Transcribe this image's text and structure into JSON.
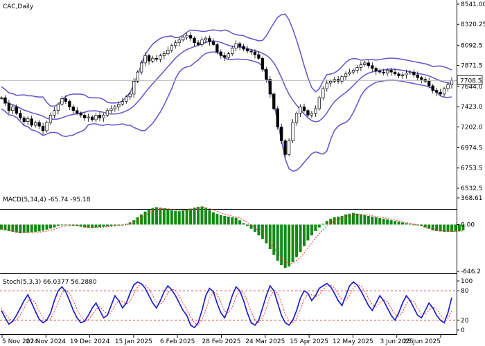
{
  "chart_data": {
    "type": "candlestick",
    "colors": {
      "bull": "#000000",
      "bear": "#000000",
      "bollinger": "#6a5acd",
      "macd_hist": "#138a13",
      "macd_signal": "#ff2a2a",
      "stoch_k": "#1c1cd6",
      "stoch_d": "#ff2a2a",
      "grid": "#c8c8c8"
    },
    "main": {
      "title": "CAC,Daily",
      "current_price": "7708.5",
      "y_ticks": [
        "8541.00",
        "8320.25",
        "8092.5",
        "7871.5",
        "7644.0",
        "7423.0",
        "7202.0",
        "6974.5",
        "6753.5",
        "6532.5"
      ],
      "ylim": [
        6532.5,
        8541.0
      ],
      "indicator": "Bollinger Bands",
      "closes": [
        7520,
        7460,
        7380,
        7420,
        7350,
        7300,
        7260,
        7290,
        7220,
        7250,
        7210,
        7160,
        7250,
        7330,
        7380,
        7450,
        7510,
        7480,
        7420,
        7380,
        7350,
        7330,
        7300,
        7310,
        7280,
        7330,
        7300,
        7330,
        7380,
        7400,
        7420,
        7450,
        7480,
        7530,
        7560,
        7700,
        7800,
        7900,
        7980,
        7920,
        7950,
        7940,
        7980,
        8000,
        8040,
        8090,
        8120,
        8150,
        8180,
        8200,
        8170,
        8120,
        8100,
        8150,
        8170,
        8130,
        8100,
        8020,
        7980,
        7960,
        8000,
        8060,
        8110,
        8080,
        8050,
        8030,
        8020,
        7990,
        7950,
        7830,
        7720,
        7560,
        7400,
        7200,
        7050,
        6900,
        7050,
        7250,
        7350,
        7420,
        7380,
        7330,
        7350,
        7400,
        7520,
        7620,
        7680,
        7700,
        7720,
        7700,
        7750,
        7780,
        7800,
        7820,
        7850,
        7880,
        7900,
        7870,
        7840,
        7810,
        7800,
        7790,
        7820,
        7800,
        7780,
        7760,
        7770,
        7790,
        7800,
        7770,
        7740,
        7720,
        7700,
        7650,
        7600,
        7580,
        7560,
        7620,
        7660,
        7708
      ]
    },
    "macd": {
      "label": "MACD(5,34,4)",
      "value1": "-65.74",
      "value2": "-95.18",
      "y_ticks": [
        "368.61",
        "0.00",
        "-646.2"
      ],
      "ylim": [
        -646.2,
        368.61
      ],
      "histogram": [
        -70,
        -80,
        -90,
        -100,
        -110,
        -120,
        -115,
        -110,
        -105,
        -100,
        -95,
        -85,
        -70,
        -55,
        -40,
        -20,
        -10,
        -5,
        -8,
        -15,
        -20,
        -30,
        -40,
        -45,
        -50,
        -40,
        -35,
        -30,
        -25,
        -20,
        -15,
        -10,
        -5,
        10,
        30,
        60,
        100,
        140,
        180,
        210,
        230,
        240,
        235,
        225,
        210,
        200,
        190,
        185,
        195,
        210,
        220,
        235,
        245,
        250,
        230,
        200,
        170,
        150,
        130,
        120,
        110,
        100,
        95,
        60,
        20,
        -20,
        -60,
        -100,
        -150,
        -200,
        -260,
        -340,
        -420,
        -500,
        -560,
        -600,
        -580,
        -520,
        -450,
        -380,
        -300,
        -220,
        -150,
        -90,
        -40,
        10,
        50,
        80,
        100,
        110,
        120,
        140,
        150,
        160,
        150,
        140,
        130,
        120,
        110,
        100,
        90,
        80,
        70,
        60,
        50,
        40,
        30,
        20,
        10,
        0,
        -10,
        -20,
        -40,
        -60,
        -80,
        -90,
        -95,
        -100,
        -100,
        -100,
        -95,
        -90,
        -80
      ],
      "signal": [
        -60,
        -70,
        -80,
        -90,
        -100,
        -108,
        -112,
        -113,
        -112,
        -110,
        -106,
        -99,
        -90,
        -78,
        -63,
        -47,
        -32,
        -21,
        -15,
        -15,
        -17,
        -22,
        -29,
        -36,
        -42,
        -41,
        -38,
        -35,
        -31,
        -27,
        -22,
        -17,
        -12,
        -3,
        10,
        30,
        58,
        90,
        126,
        160,
        188,
        209,
        219,
        222,
        217,
        211,
        203,
        196,
        196,
        201,
        208,
        218,
        230,
        240,
        236,
        222,
        202,
        182,
        162,
        145,
        130,
        117,
        108,
        89,
        62,
        29,
        -7,
        -44,
        -87,
        -132,
        -184,
        -246,
        -316,
        -390,
        -458,
        -515,
        -541,
        -532,
        -499,
        -451,
        -391,
        -323,
        -254,
        -189,
        -129,
        -73,
        -24,
        17,
        50,
        74,
        92,
        111,
        127,
        140,
        144,
        143,
        138,
        131,
        122,
        113,
        104,
        94,
        84,
        74,
        63,
        52,
        41,
        29,
        16,
        3,
        -8,
        -20,
        -36,
        -52,
        -68,
        -77,
        -84,
        -90,
        -94,
        -96,
        -96,
        -93,
        -88
      ]
    },
    "stoch": {
      "label": "Stoch(5,3,3)",
      "value1": "66.0377",
      "value2": "56.2880",
      "y_ticks": [
        "100",
        "80",
        "20",
        "0"
      ],
      "ylim": [
        0,
        100
      ],
      "k": [
        40,
        25,
        12,
        18,
        30,
        45,
        60,
        72,
        55,
        38,
        22,
        15,
        20,
        35,
        60,
        80,
        88,
        78,
        60,
        40,
        25,
        15,
        18,
        30,
        45,
        55,
        40,
        25,
        30,
        50,
        70,
        60,
        45,
        55,
        75,
        92,
        98,
        94,
        85,
        70,
        55,
        45,
        60,
        78,
        90,
        82,
        70,
        55,
        40,
        30,
        10,
        5,
        15,
        40,
        70,
        85,
        78,
        55,
        35,
        25,
        45,
        70,
        88,
        80,
        60,
        35,
        15,
        10,
        20,
        45,
        70,
        90,
        80,
        55,
        30,
        15,
        10,
        20,
        40,
        65,
        80,
        75,
        60,
        70,
        85,
        90,
        95,
        88,
        75,
        60,
        50,
        70,
        90,
        98,
        92,
        80,
        65,
        50,
        40,
        55,
        70,
        60,
        45,
        30,
        20,
        35,
        55,
        70,
        60,
        45,
        30,
        25,
        40,
        55,
        45,
        30,
        20,
        15,
        35,
        66
      ],
      "d": [
        45,
        33,
        24,
        18,
        20,
        31,
        45,
        59,
        62,
        55,
        38,
        25,
        19,
        23,
        38,
        58,
        76,
        82,
        75,
        59,
        42,
        27,
        19,
        21,
        31,
        43,
        47,
        40,
        32,
        35,
        50,
        60,
        58,
        53,
        58,
        74,
        88,
        95,
        92,
        83,
        70,
        57,
        53,
        61,
        76,
        83,
        81,
        69,
        55,
        42,
        27,
        15,
        10,
        20,
        42,
        65,
        78,
        73,
        56,
        38,
        35,
        47,
        68,
        79,
        76,
        58,
        37,
        20,
        15,
        25,
        45,
        68,
        80,
        75,
        55,
        33,
        18,
        15,
        23,
        42,
        62,
        73,
        72,
        68,
        72,
        82,
        90,
        91,
        86,
        74,
        62,
        60,
        70,
        86,
        93,
        90,
        79,
        65,
        52,
        48,
        55,
        62,
        58,
        45,
        32,
        28,
        37,
        53,
        62,
        58,
        45,
        33,
        32,
        40,
        47,
        43,
        32,
        22,
        23,
        39
      ]
    },
    "x_ticks": [
      "5 Nov 2024",
      "27 Nov 2024",
      "19 Dec 2024",
      "15 Jan 2025",
      "6 Feb 2025",
      "28 Feb 2025",
      "24 Mar 2025",
      "15 Apr 2025",
      "12 May 2025",
      "3 Jun 2025",
      "25 Jun 2025"
    ]
  }
}
